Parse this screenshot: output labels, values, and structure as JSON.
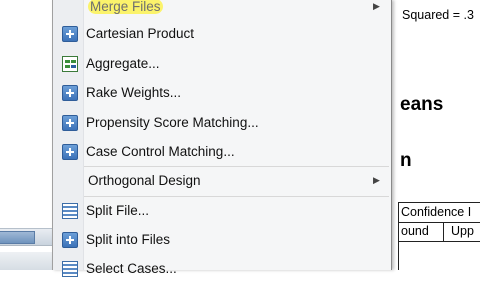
{
  "menu": {
    "items": [
      {
        "id": "merge",
        "label": "Merge Files",
        "icon": "none",
        "submenu": true,
        "highlighted": true
      },
      {
        "id": "cartesian",
        "label": "Cartesian Product",
        "icon": "plus-icon",
        "submenu": false
      },
      {
        "id": "aggregate",
        "label": "Aggregate...",
        "icon": "aggregate-icon",
        "submenu": false
      },
      {
        "id": "rake",
        "label": "Rake Weights...",
        "icon": "plus-icon",
        "submenu": false
      },
      {
        "id": "psm",
        "label": "Propensity Score Matching...",
        "icon": "plus-icon",
        "submenu": false
      },
      {
        "id": "ccm",
        "label": "Case Control Matching...",
        "icon": "plus-icon",
        "submenu": false
      },
      {
        "id": "orthogonal",
        "label": "Orthogonal Design",
        "icon": "none",
        "submenu": true
      },
      {
        "id": "split",
        "label": "Split File...",
        "icon": "grid-icon",
        "submenu": false
      },
      {
        "id": "splitfiles",
        "label": "Split into Files",
        "icon": "plus-icon",
        "submenu": false
      },
      {
        "id": "select",
        "label": "Select Cases...",
        "icon": "grid-icon",
        "submenu": false
      }
    ],
    "highlight_color": "#fbf36b"
  },
  "output": {
    "rsq_text": "Squared = .3",
    "heading": "eans",
    "subheading": "n",
    "ci_header": "Confidence I",
    "col1": "ound",
    "col2": "Upp"
  }
}
